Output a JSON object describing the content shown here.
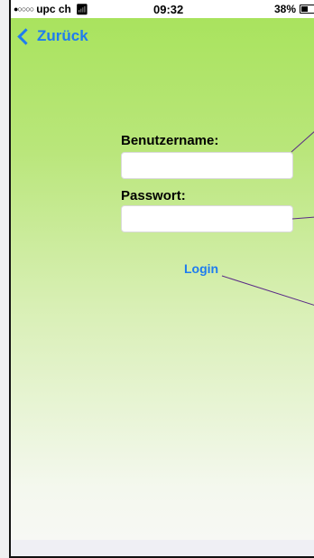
{
  "status_bar": {
    "signal": "●○○○○",
    "carrier": "upc ch",
    "wifi_icon": "wifi-icon",
    "time": "09:32",
    "battery_percent": "38%",
    "battery_level": 0.38
  },
  "nav": {
    "back_label": "Zurück",
    "back_icon": "chevron-left-icon"
  },
  "form": {
    "username_label": "Benutzername:",
    "username_value": "",
    "password_label": "Passwort:",
    "password_value": "",
    "login_label": "Login"
  },
  "colors": {
    "accent": "#1e7cf0",
    "background_top": "#a9e35e",
    "background_bottom": "#f7f8f4",
    "annotation_line": "#5a2a86"
  }
}
